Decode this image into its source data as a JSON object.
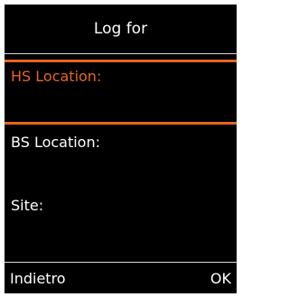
{
  "header": {
    "title": "Log for"
  },
  "menu": {
    "items": [
      {
        "label": "HS Location:",
        "selected": true
      },
      {
        "label": "BS Location:",
        "selected": false
      },
      {
        "label": "Site:",
        "selected": false
      }
    ]
  },
  "softkeys": {
    "left": "Indietro",
    "right": "OK"
  },
  "colors": {
    "background": "#000000",
    "text": "#ffffff",
    "accent": "#e8641e"
  }
}
